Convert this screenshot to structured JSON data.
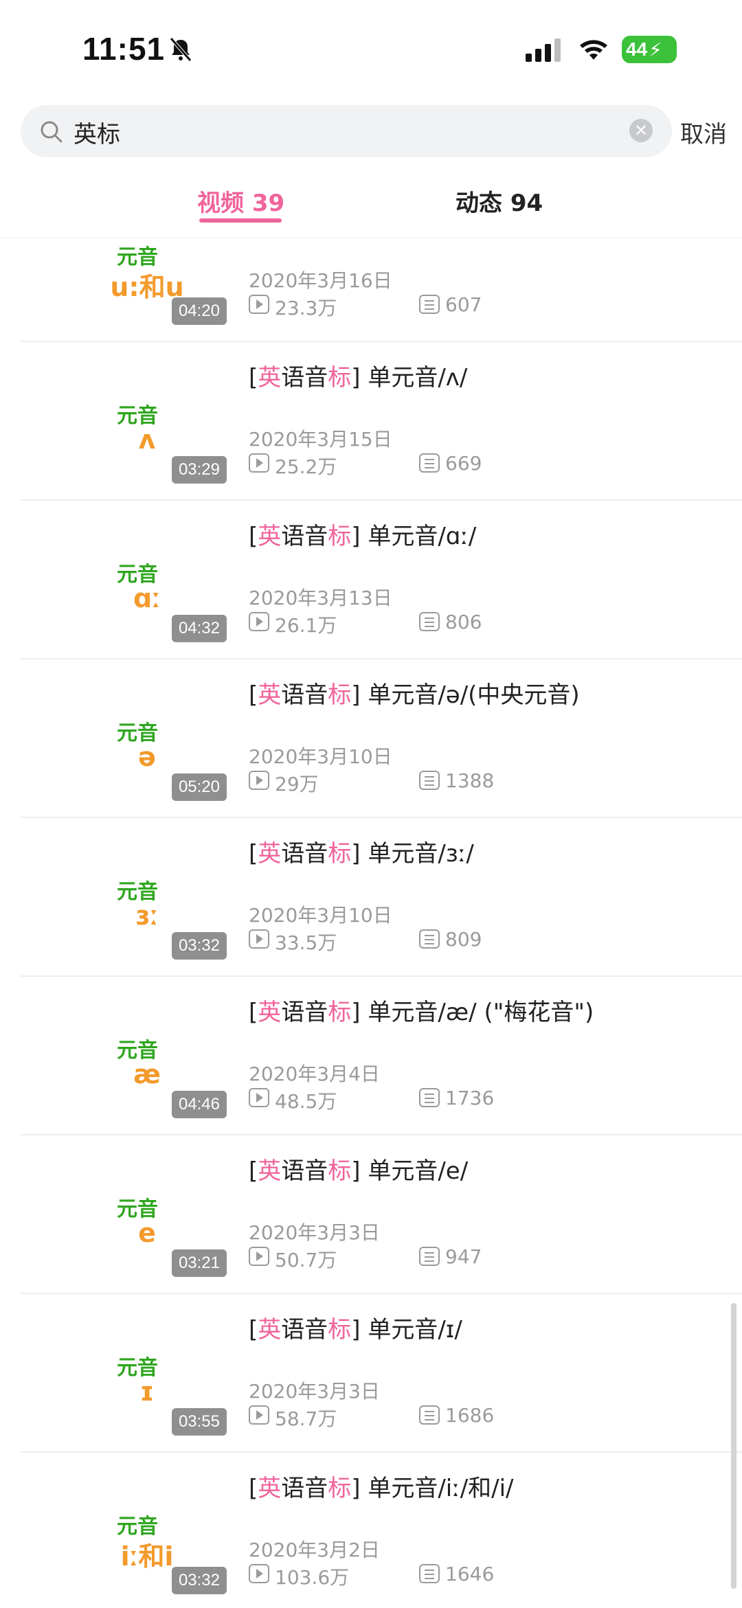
{
  "status_bar": {
    "time": "11:51",
    "battery": "44"
  },
  "search": {
    "query": "英标",
    "cancel_label": "取消"
  },
  "tabs": [
    {
      "label": "视频 39",
      "active": true
    },
    {
      "label": "动态 94",
      "active": false
    }
  ],
  "results": [
    {
      "thumb_top": "元音",
      "thumb_symbol": "u:和u",
      "duration": "04:20",
      "title_prefix": "",
      "title_hl1": "",
      "title_mid": "",
      "title_hl2": "",
      "title_rest": "",
      "date": "2020年3月16日",
      "views": "23.3万",
      "comments": "607"
    },
    {
      "thumb_top": "元音",
      "thumb_symbol": "ʌ",
      "duration": "03:29",
      "title_prefix": "[",
      "title_hl1": "英",
      "title_mid": "语音",
      "title_hl2": "标",
      "title_rest": "] 单元音/ʌ/",
      "date": "2020年3月15日",
      "views": "25.2万",
      "comments": "669"
    },
    {
      "thumb_top": "元音",
      "thumb_symbol": "ɑː",
      "duration": "04:32",
      "title_prefix": "[",
      "title_hl1": "英",
      "title_mid": "语音",
      "title_hl2": "标",
      "title_rest": "] 单元音/ɑː/",
      "date": "2020年3月13日",
      "views": "26.1万",
      "comments": "806"
    },
    {
      "thumb_top": "元音",
      "thumb_symbol": "ə",
      "duration": "05:20",
      "title_prefix": "[",
      "title_hl1": "英",
      "title_mid": "语音",
      "title_hl2": "标",
      "title_rest": "] 单元音/ə/(中央元音)",
      "date": "2020年3月10日",
      "views": "29万",
      "comments": "1388"
    },
    {
      "thumb_top": "元音",
      "thumb_symbol": "ɜː",
      "duration": "03:32",
      "title_prefix": "[",
      "title_hl1": "英",
      "title_mid": "语音",
      "title_hl2": "标",
      "title_rest": "] 单元音/ɜː/",
      "date": "2020年3月10日",
      "views": "33.5万",
      "comments": "809"
    },
    {
      "thumb_top": "元音",
      "thumb_symbol": "æ",
      "duration": "04:46",
      "title_prefix": "[",
      "title_hl1": "英",
      "title_mid": "语音",
      "title_hl2": "标",
      "title_rest": "] 单元音/æ/ (\"梅花音\")",
      "date": "2020年3月4日",
      "views": "48.5万",
      "comments": "1736"
    },
    {
      "thumb_top": "元音",
      "thumb_symbol": "e",
      "duration": "03:21",
      "title_prefix": "[",
      "title_hl1": "英",
      "title_mid": "语音",
      "title_hl2": "标",
      "title_rest": "] 单元音/e/",
      "date": "2020年3月3日",
      "views": "50.7万",
      "comments": "947"
    },
    {
      "thumb_top": "元音",
      "thumb_symbol": "ɪ",
      "duration": "03:55",
      "title_prefix": "[",
      "title_hl1": "英",
      "title_mid": "语音",
      "title_hl2": "标",
      "title_rest": "] 单元音/ɪ/",
      "date": "2020年3月3日",
      "views": "58.7万",
      "comments": "1686"
    },
    {
      "thumb_top": "元音",
      "thumb_symbol": "iː和i",
      "duration": "03:32",
      "title_prefix": "[",
      "title_hl1": "英",
      "title_mid": "语音",
      "title_hl2": "标",
      "title_rest": "] 单元音/iː/和/i/",
      "date": "2020年3月2日",
      "views": "103.6万",
      "comments": "1646"
    }
  ]
}
